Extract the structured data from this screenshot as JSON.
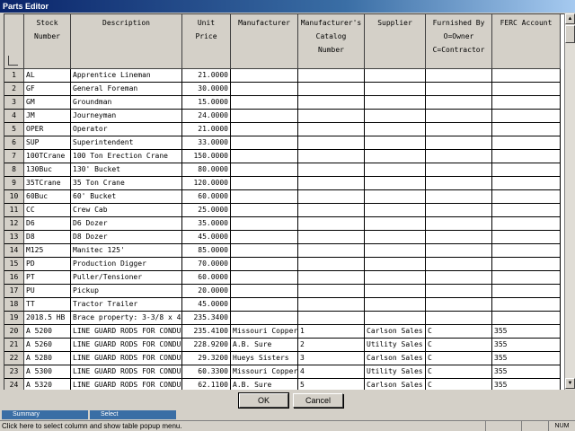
{
  "window": {
    "title": "Parts Editor"
  },
  "grid": {
    "columns": [
      {
        "key": "num",
        "label": ""
      },
      {
        "key": "stock",
        "label": "Stock\nNumber"
      },
      {
        "key": "desc",
        "label": "Description"
      },
      {
        "key": "price",
        "label": "Unit\nPrice"
      },
      {
        "key": "mfr",
        "label": "Manufacturer"
      },
      {
        "key": "catalog",
        "label": "Manufacturer's\nCatalog\nNumber"
      },
      {
        "key": "supplier",
        "label": "Supplier"
      },
      {
        "key": "furnished",
        "label": "Furnished By\nO=Owner\nC=Contractor"
      },
      {
        "key": "ferc",
        "label": "FERC Account"
      }
    ],
    "rows": [
      [
        "1",
        "AL",
        "Apprentice Lineman",
        "21.0000",
        "",
        "",
        "",
        "",
        ""
      ],
      [
        "2",
        "GF",
        "General Foreman",
        "30.0000",
        "",
        "",
        "",
        "",
        ""
      ],
      [
        "3",
        "GM",
        "Groundman",
        "15.0000",
        "",
        "",
        "",
        "",
        ""
      ],
      [
        "4",
        "JM",
        "Journeyman",
        "24.0000",
        "",
        "",
        "",
        "",
        ""
      ],
      [
        "5",
        "OPER",
        "Operator",
        "21.0000",
        "",
        "",
        "",
        "",
        ""
      ],
      [
        "6",
        "SUP",
        "Superintendent",
        "33.0000",
        "",
        "",
        "",
        "",
        ""
      ],
      [
        "7",
        "100TCrane",
        "100 Ton Erection Crane",
        "150.0000",
        "",
        "",
        "",
        "",
        ""
      ],
      [
        "8",
        "130Buc",
        "130' Bucket",
        "80.0000",
        "",
        "",
        "",
        "",
        ""
      ],
      [
        "9",
        "35TCrane",
        "35 Ton Crane",
        "120.0000",
        "",
        "",
        "",
        "",
        ""
      ],
      [
        "10",
        "60Buc",
        "60' Bucket",
        "60.0000",
        "",
        "",
        "",
        "",
        ""
      ],
      [
        "11",
        "CC",
        "Crew Cab",
        "25.0000",
        "",
        "",
        "",
        "",
        ""
      ],
      [
        "12",
        "D6",
        "D6 Dozer",
        "35.0000",
        "",
        "",
        "",
        "",
        ""
      ],
      [
        "13",
        "D8",
        "D8 Dozer",
        "45.0000",
        "",
        "",
        "",
        "",
        ""
      ],
      [
        "14",
        "M125",
        "Manitec 125'",
        "85.0000",
        "",
        "",
        "",
        "",
        ""
      ],
      [
        "15",
        "PD",
        "Production Digger",
        "70.0000",
        "",
        "",
        "",
        "",
        ""
      ],
      [
        "16",
        "PT",
        "Puller/Tensioner",
        "60.0000",
        "",
        "",
        "",
        "",
        ""
      ],
      [
        "17",
        "PU",
        "Pickup",
        "20.0000",
        "",
        "",
        "",
        "",
        ""
      ],
      [
        "18",
        "TT",
        "Tractor Trailer",
        "45.0000",
        "",
        "",
        "",
        "",
        ""
      ],
      [
        "19",
        "2018.5 HB",
        "Brace property: 3-3/8 x 4",
        "235.3400",
        "",
        "",
        "",
        "",
        ""
      ],
      [
        "20",
        "A 5200",
        "LINE GUARD RODS FOR CONDU",
        "235.4100",
        "Missouri Copper",
        "1",
        "Carlson Sales",
        "C",
        "355"
      ],
      [
        "21",
        "A 5260",
        "LINE GUARD RODS FOR CONDU",
        "228.9200",
        "A.B. Sure",
        "2",
        "Utility Sales",
        "C",
        "355"
      ],
      [
        "22",
        "A 5280",
        "LINE GUARD RODS FOR CONDU",
        "29.3200",
        "Hueys Sisters",
        "3",
        "Carlson Sales",
        "C",
        "355"
      ],
      [
        "23",
        "A 5300",
        "LINE GUARD RODS FOR CONDU",
        "60.3300",
        "Missouri Copper",
        "4",
        "Utility Sales",
        "C",
        "355"
      ],
      [
        "24",
        "A 5320",
        "LINE GUARD RODS FOR CONDU",
        "62.1100",
        "A.B. Sure",
        "5",
        "Carlson Sales",
        "C",
        "355"
      ]
    ]
  },
  "buttons": {
    "ok": "OK",
    "cancel": "Cancel"
  },
  "taskbar": {
    "items": [
      "Summary",
      "Select"
    ]
  },
  "status": {
    "text": "Click here to select column and show table popup menu.",
    "pane": "NUM"
  }
}
